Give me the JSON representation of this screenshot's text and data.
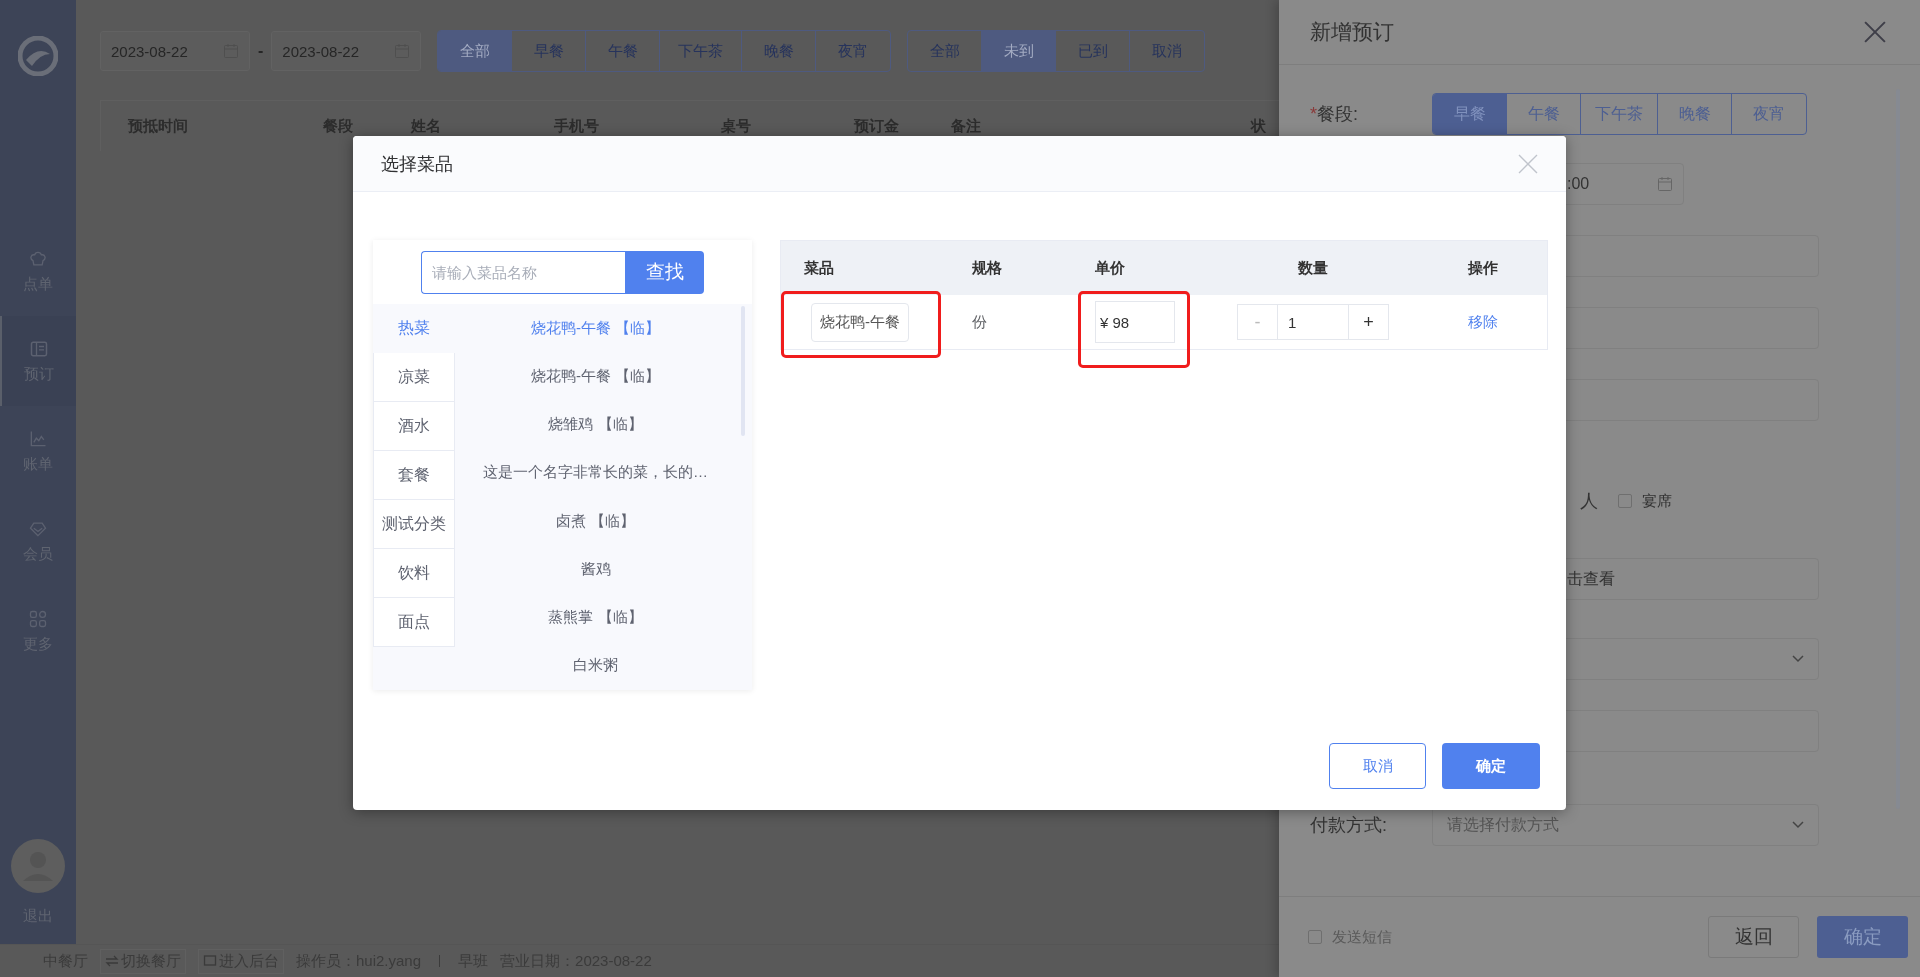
{
  "sidebar": {
    "items": [
      {
        "label": "点单",
        "selected": false
      },
      {
        "label": "预订",
        "selected": true
      },
      {
        "label": "账单",
        "selected": false
      },
      {
        "label": "会员",
        "selected": false
      },
      {
        "label": "更多",
        "selected": false
      }
    ],
    "logout": "退出"
  },
  "filters": {
    "date_start": "2023-08-22",
    "date_separator": "-",
    "date_end": "2023-08-22",
    "meal_periods": [
      {
        "label": "全部",
        "selected": true
      },
      {
        "label": "早餐",
        "selected": false
      },
      {
        "label": "午餐",
        "selected": false
      },
      {
        "label": "下午茶",
        "selected": false
      },
      {
        "label": "晚餐",
        "selected": false
      },
      {
        "label": "夜宵",
        "selected": false
      }
    ],
    "arrival_status": [
      {
        "label": "全部",
        "selected": false
      },
      {
        "label": "未到",
        "selected": true
      },
      {
        "label": "已到",
        "selected": false
      },
      {
        "label": "取消",
        "selected": false
      }
    ]
  },
  "table": {
    "columns": [
      "预抵时间",
      "餐段",
      "姓名",
      "手机号",
      "桌号",
      "预订金",
      "备注",
      "状"
    ]
  },
  "status_bar": {
    "restaurant": "中餐厅",
    "switch_button": "切换餐厅",
    "admin_button": "进入后台",
    "operator": "操作员：hui2.yang",
    "shift": "早班",
    "business_date": "营业日期：2023-08-22"
  },
  "drawer": {
    "title": "新增预订",
    "required_mark": "*",
    "meal_label": "餐段:",
    "meal_options": [
      {
        "label": "早餐",
        "selected": true
      },
      {
        "label": "午餐",
        "selected": false
      },
      {
        "label": "下午茶",
        "selected": false
      },
      {
        "label": "晚餐",
        "selected": false
      },
      {
        "label": "夜宵",
        "selected": false
      }
    ],
    "time_value": ":00",
    "guest_unit": "人",
    "banquet": {
      "label": "宴席",
      "checked": false
    },
    "view_hint": "击查看",
    "payment_label": "付款方式:",
    "payment_placeholder": "请选择付款方式",
    "sms": {
      "label": "发送短信",
      "checked": false
    },
    "back_button": "返回",
    "confirm_button": "确定"
  },
  "modal": {
    "title": "选择菜品",
    "search": {
      "placeholder": "请输入菜品名称",
      "button": "查找"
    },
    "categories": [
      {
        "label": "热菜",
        "selected": true
      },
      {
        "label": "凉菜",
        "selected": false
      },
      {
        "label": "酒水",
        "selected": false
      },
      {
        "label": "套餐",
        "selected": false
      },
      {
        "label": "测试分类",
        "selected": false
      },
      {
        "label": "饮料",
        "selected": false
      },
      {
        "label": "面点",
        "selected": false
      }
    ],
    "dishes": [
      {
        "name": "烧花鸭-午餐 【临】",
        "selected": true
      },
      {
        "name": "烧花鸭-午餐 【临】",
        "selected": false
      },
      {
        "name": "烧雏鸡 【临】",
        "selected": false
      },
      {
        "name": "这是一个名字非常长的菜，长的…",
        "selected": false
      },
      {
        "name": "卤煮 【临】",
        "selected": false
      },
      {
        "name": "酱鸡",
        "selected": false
      },
      {
        "name": "蒸熊掌 【临】",
        "selected": false
      },
      {
        "name": "白米粥",
        "selected": false
      }
    ],
    "columns": [
      "菜品",
      "规格",
      "单价",
      "数量",
      "操作"
    ],
    "rows": [
      {
        "dish": "烧花鸭-午餐",
        "spec": "份",
        "price": "¥ 98",
        "quantity": "1",
        "minus": "-",
        "plus": "+",
        "action": "移除"
      }
    ],
    "cancel_button": "取消",
    "confirm_button": "确定"
  }
}
